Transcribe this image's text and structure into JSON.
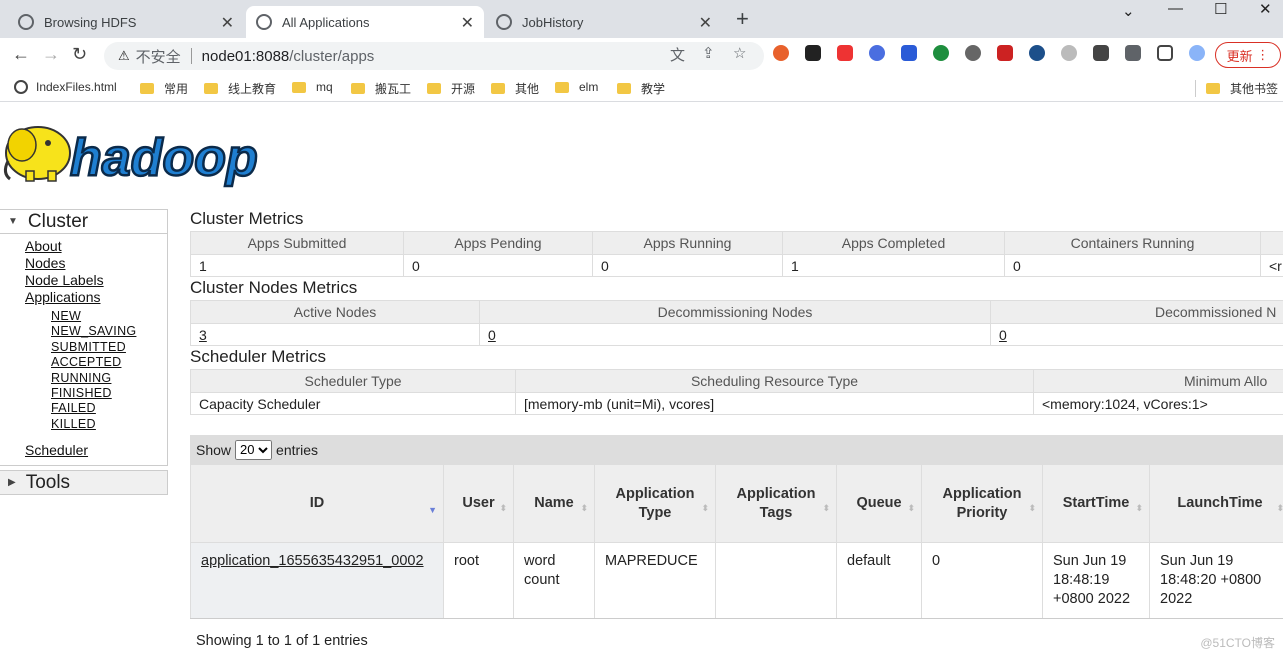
{
  "browser": {
    "tabs": [
      {
        "title": "Browsing HDFS"
      },
      {
        "title": "All Applications"
      },
      {
        "title": "JobHistory"
      }
    ],
    "insecure_label": "不安全",
    "url_host": "node01:8088",
    "url_path": "/cluster/apps",
    "update_label": "更新",
    "bookmarks": [
      "IndexFiles.html",
      "常用",
      "线上教育",
      "mq",
      "搬瓦工",
      "开源",
      "其他",
      "elm",
      "教学"
    ],
    "other_bookmarks": "其他书签"
  },
  "logo": {
    "text": "hadoop"
  },
  "sidebar": {
    "cluster_title": "Cluster",
    "links": [
      "About",
      "Nodes",
      "Node Labels",
      "Applications"
    ],
    "app_states": [
      "NEW",
      "NEW_SAVING",
      "SUBMITTED",
      "ACCEPTED",
      "RUNNING",
      "FINISHED",
      "FAILED",
      "KILLED"
    ],
    "scheduler": "Scheduler",
    "tools_title": "Tools"
  },
  "cluster_metrics": {
    "title": "Cluster Metrics",
    "headers": [
      "Apps Submitted",
      "Apps Pending",
      "Apps Running",
      "Apps Completed",
      "Containers Running"
    ],
    "values": [
      "1",
      "0",
      "0",
      "1",
      "0"
    ],
    "overflow": "<r"
  },
  "nodes_metrics": {
    "title": "Cluster Nodes Metrics",
    "headers": [
      "Active Nodes",
      "Decommissioning Nodes",
      "Decommissioned N"
    ],
    "values": [
      "3",
      "0",
      "0"
    ]
  },
  "scheduler_metrics": {
    "title": "Scheduler Metrics",
    "headers": [
      "Scheduler Type",
      "Scheduling Resource Type",
      "Minimum Allo"
    ],
    "values": [
      "Capacity Scheduler",
      "[memory-mb (unit=Mi), vcores]",
      "<memory:1024, vCores:1>"
    ]
  },
  "apps": {
    "show_label": "Show",
    "entries_label": "entries",
    "page_size": "20",
    "headers": [
      "ID",
      "User",
      "Name",
      "Application Type",
      "Application Tags",
      "Queue",
      "Application Priority",
      "StartTime",
      "LaunchTime"
    ],
    "row": {
      "id": "application_1655635432951_0002",
      "user": "root",
      "name": "word count",
      "type": "MAPREDUCE",
      "tags": "",
      "queue": "default",
      "priority": "0",
      "start": "Sun Jun 19 18:48:19 +0800 2022",
      "launch": "Sun Jun 19 18:48:20 +0800 2022"
    },
    "footer": "Showing 1 to 1 of 1 entries"
  },
  "watermark": "@51CTO博客",
  "colors": {
    "accent": "#1a73e8",
    "update_red": "#d93025",
    "hadoop_blue": "#1f7fd1",
    "hadoop_yellow": "#f7e31b"
  }
}
